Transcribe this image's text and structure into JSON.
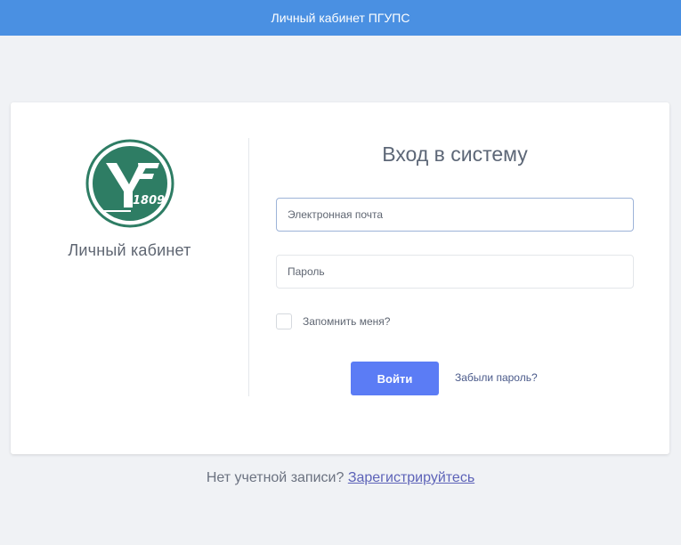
{
  "header": {
    "title": "Личный кабинет ПГУПС"
  },
  "brand": {
    "logo_icon": "university-seal-icon",
    "logo_text": "1809",
    "label": "Личный кабинет"
  },
  "login": {
    "title": "Вход в систему",
    "email_placeholder": "Электронная почта",
    "password_placeholder": "Пароль",
    "remember_label": "Запомнить меня?",
    "submit_label": "Войти",
    "forgot_label": "Забыли пароль?"
  },
  "register": {
    "prompt": "Нет учетной записи?",
    "link_label": "Зарегистрируйтесь"
  },
  "colors": {
    "header": "#4a90e2",
    "logo": "#2e7d64",
    "button": "#5b7cf5",
    "background": "#f0f2f5"
  }
}
